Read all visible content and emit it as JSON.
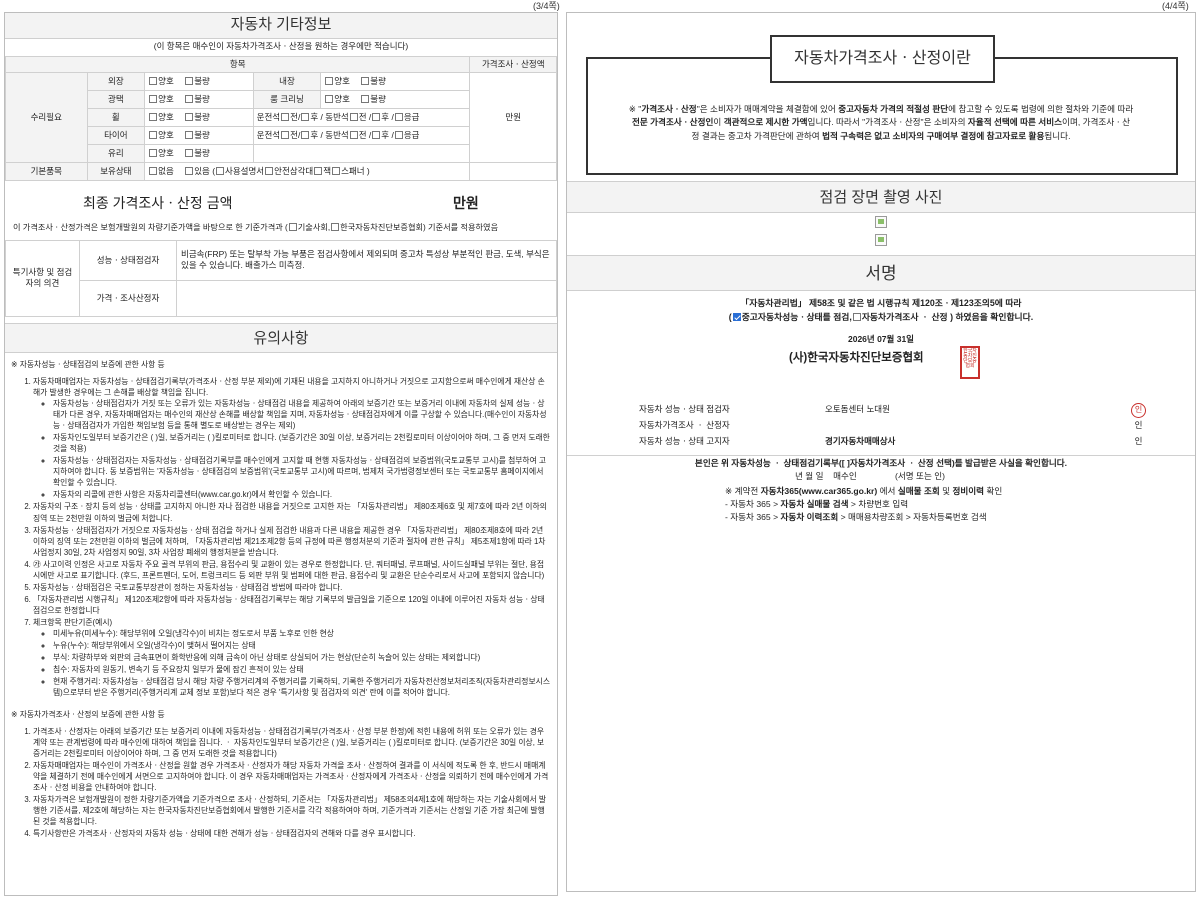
{
  "page_numbers": {
    "left": "(3/4쪽)",
    "right": "(4/4쪽)"
  },
  "other_info": {
    "title": "자동차 기타정보",
    "note": "(이 항목은 매수인이 자동차가격조사ㆍ산정을 원하는 경우에만 적습니다)",
    "col_item": "항목",
    "col_price": "가격조사ㆍ산정액",
    "repair_label": "수리필요",
    "basic_label": "기본품목",
    "unit_manwon": "만원",
    "opt_good": "양호",
    "opt_bad": "불량",
    "items": {
      "exterior": "외장",
      "interior": "내장",
      "gloss": "광택",
      "room_cleaning": "룸 크리닝",
      "wheel": "휠",
      "tire": "타이어",
      "glass": "유리",
      "possession": "보유상태"
    },
    "wheel_driver": "운전석",
    "passenger": "동반석",
    "front": "전",
    "rear": "후",
    "emergency": "응급",
    "possession_none": "없음",
    "possession_has": "있음 (",
    "manual": "사용설명서",
    "triangle": "안전삼각대",
    "jack": "잭",
    "spanner": "스패너 )"
  },
  "final_price": {
    "title": "최종 가격조사ㆍ산정 금액",
    "unit": "만원",
    "basis_pre": "이 가격조사ㆍ산정가격은 보험개발원의 차량기준가액을 바탕으로 한 기준가격과 (",
    "basis_opt1": "기술사회,",
    "basis_opt2": "한국자동차진단보증협회) 기준서를 적용하였음",
    "special_label": "특기사항 및 점검자의 의견",
    "perf_label": "성능ㆍ상태점검자",
    "perf_text": "비금속(FRP) 또는 탈부착 가능 부품은 점검사항에서 제외되며 중고차 특성상 부분적인 판금, 도색, 부식은 있을 수 있습니다. 배출가스 미측정.",
    "price_label": "가격ㆍ조사산정자"
  },
  "notice": {
    "title": "유의사항",
    "h1": "※ 자동차성능ㆍ상태점검의 보증에 관한 사항 등",
    "s1_1": "자동차매매업자는 자동차성능ㆍ상태점검기록부(가격조사ㆍ산정 부분 제외)에 기재된 내용을 고지하지 아니하거나 거짓으로 고지함으로써 매수인에게 재산상 손해가 발생한 경우에는 그 손해를 배상할 책임을 집니다.",
    "s1_sub1": "자동차성능ㆍ상태점검자가 거짓 또는 오류가 있는 자동차성능ㆍ상태점검 내용을 제공하여 아래의 보증기간 또는 보증거리 이내에 자동차의 실제 성능ㆍ상태가 다른 경우, 자동차매매업자는 매수인의 재산상 손해를 배상할 책임을 지며, 자동차성능ㆍ상태점검자에게 이를 구상할 수 있습니다.(매수인이 자동차성능ㆍ상태점검자가 가입한 책임보험 등을 통해 별도로 배상받는 경우는 제외)",
    "s1_sub2": "자동차인도일부터 보증기간은 (      )일, 보증거리는 (      )킬로미터로 합니다. (보증기간은 30일 이상, 보증거리는 2천킬로미터 이상이어야 하며, 그 중 먼저 도래한 것을 적용)",
    "s1_sub3": "자동차성능ㆍ상태점검자는 자동차성능ㆍ상태점검기록부를 매수인에게 고지할 때 현행 자동차성능ㆍ상태점검의 보증범위(국토교통부 고시)를 첨부하여 고지하여야 합니다. 동 보증범위는 '자동차성능ㆍ상태점검의 보증범위'(국토교통부 고시)에 따르며, 법제처 국가법령정보센터 또는 국토교통부 홈페이지에서 확인할 수 있습니다.",
    "s1_sub4": "자동차의 리콜에 관한 사항은 자동차리콜센터(www.car.go.kr)에서 확인할 수 있습니다.",
    "s2": "자동차의 구조ㆍ장치 등의 성능ㆍ상태를 고지하지 아니한 자나 점검한 내용을 거짓으로 고지한 자는 「자동차관리법」 제80조제6호 및 제7호에 따라 2년 이하의 징역 또는 2천만원 이하의 벌금에 처합니다.",
    "s3": "자동차성능ㆍ상태점검자가 거짓으로 자동차성능ㆍ상태 점검을 하거나 실제 점검한 내용과 다른 내용을 제공한 경우 「자동차관리법」 제80조제8호에 따라 2년 이하의 징역 또는 2천만원 이하의 벌금에 처하며, 「자동차관리법 제21조제2항 등의 규정에 따른 행정처분의 기준과 절차에 관한 규칙」 제5조제1항에 따라 1차 사업정지 30일, 2차 사업정지 90일, 3차 사업장 폐쇄의 행정처분을 받습니다.",
    "s4": "㉮ 사고이력 인정은 사고로 자동차 주요 골격 부위의 판금, 용접수리 및 교환이 있는 경우로 한정합니다. 단, 쿼터패널, 루프패널, 사이드실패널 부위는 절단, 용접 시에만 사고로 표기합니다. (후드, 프론트펜더, 도어, 트렁크리드 등 외판 부위 및 범퍼에 대한 판금, 용접수리 및 교환은 단순수리로서 사고에 포함되지 않습니다)",
    "s5": "자동차성능ㆍ상태점검은 국토교통부장관이 정하는 자동차성능ㆍ상태점검 방법에 따라야 합니다.",
    "s6": "「자동차관리법 시행규칙」 제120조제2항에 따라 자동차성능ㆍ상태점검기록부는 해당 기록부의 발급일을 기준으로 120일 이내에 이루어진 자동차 성능ㆍ상태점검으로 한정합니다",
    "s7": "체크항목 판단기준(예시)",
    "s7_sub1": "미세누유(미세누수): 해당부위에 오일(냉각수)이 비치는 정도로서 부품 노후로 인한 현상",
    "s7_sub2": "누유(누수): 해당부위에서 오일(냉각수)이 맺혀서 떨어지는 상태",
    "s7_sub3": "부식: 차량하부와 외판의 금속표면이 화학반응에 의해 금속이 아닌 상태로 상실되어 가는 현상(단순히 녹슬어 있는 상태는 제외합니다)",
    "s7_sub4": "침수: 자동차의 원동기, 변속기 등 주요장치 일부가 물에 잠긴 흔적이 있는 상태",
    "s7_sub5": "현재 주행거리: 자동차성능ㆍ상태점검 당시 해당 차량 주행거리계의 주행거리를 기록하되, 기록한 주행거리가 자동차전산정보처리조직(자동차관리정보시스템)으로부터 받은 주행거리(주행거리계 교체 정보 포함)보다 적은 경우 '특기사항 및 점검자의 의견' 란에 이를 적어야 합니다.",
    "h2": "※ 자동차가격조사ㆍ산정의 보증에 관한 사항 등",
    "p1": "가격조사ㆍ산정자는 아래의 보증기간 또는 보증거리 이내에 자동차성능ㆍ상태점검기록부(가격조사ㆍ산정 부분 한정)에 적힌 내용에 허위 또는 오류가 있는 경우 계약 또는 관계법령에 따라 매수인에 대하여 책임을 집니다. ㆍ 자동차인도일부터 보증기간은 (      )일, 보증거리는 (      )킬로미터로 합니다. (보증기간은 30일 이상, 보증거리는 2천킬로미터 이상이어야 하며, 그 중 먼저 도래한 것을 적용합니다)",
    "p2": "자동차매매업자는 매수인이 가격조사ㆍ산정을 원할 경우 가격조사ㆍ산정자가 해당 자동차 가격을 조사ㆍ산정하여 결과를 이 서식에 적도록 한 후, 반드시 매매계약을 체결하기 전에 매수인에게 서면으로 고지하여야 합니다. 이 경우 자동차매매업자는 가격조사ㆍ산정자에게 가격조사ㆍ산정을 의뢰하기 전에 매수인에게 가격조사ㆍ산정 비용을 안내하여야 합니다.",
    "p3": "자동차가격은 보험개발원이 정한 차량기준가액을 기준가격으로 조사ㆍ산정하되, 기준서는 「자동차관리법」 제58조의4제1호에 해당하는 자는 기술사회에서 발행한 기준서를, 제2호에 해당하는 자는 한국자동차진단보증협회에서 발행한 기준서를 각각 적용하여야 하며, 기준가격과 기준서는 산정일 기준 가장 최근에 발행된 것을 적용합니다.",
    "p4": "특기사항란은 가격조사ㆍ산정자의 자동차 성능ㆍ상태에 대한 견해가 성능ㆍ상태점검자의 견해와 다를 경우 표시합니다."
  },
  "about": {
    "title": "자동차가격조사ㆍ산정이란",
    "t1": "※ \"",
    "t2": "가격조사ㆍ산정",
    "t3": "\"은 소비자가 매매계약을 체결함에 있어 ",
    "t4": "중고자동차 가격의 적절성 판단",
    "t5": "에 참고할 수 있도록 법령에 의한 절차와 기준에 따라 ",
    "t6": "전문 가격조사ㆍ산정인",
    "t7": "이 ",
    "t8": "객관적으로 제시한 가액",
    "t9": "입니다. 따라서 \"가격조사ㆍ산정\"은 소비자의 ",
    "t10": "자율적 선택에 따른 서비스",
    "t11": "이며, 가격조사ㆍ산정 결과는 중고차 가격판단에 관하여 ",
    "t12": "법적 구속력은 없고 소비자의 구매여부 결정에 참고자료로 활용",
    "t13": "됩니다."
  },
  "photos": {
    "title": "점검 장면 촬영 사진"
  },
  "signature": {
    "title": "서명",
    "law_line": "「자동차관리법」 제58조 및 같은 법 시행규칙 제120조ㆍ제123조의5에 따라",
    "confirm_pre": "(",
    "confirm_opt1": "중고자동차성능ㆍ상태를 점검,",
    "confirm_opt2": "자동차가격조사 ㆍ 산정 ) 하였음을 확인합니다.",
    "date": "2026년 07월  31일",
    "org": "(사)한국자동차진단보증협회",
    "org_seal": "한국자동차진단보증협회",
    "rows": [
      {
        "role": "자동차 성능ㆍ상태 점검자",
        "name": "오토돔센터 노대원",
        "mark": "인"
      },
      {
        "role": "자동차가격조사 ㆍ 산정자",
        "name": "",
        "mark": "인"
      },
      {
        "role": "자동차 성능ㆍ상태 고지자",
        "name": "경기자동차매매상사",
        "mark": "인"
      }
    ],
    "buyer_line": "본인은 위 자동차성능 ㆍ 상태점검기록부([  ]자동차가격조사 ㆍ 산정 선택)를 발급받은 사실을 확인합니다.",
    "buyer_date": "년    월    일",
    "buyer_role": "매수인",
    "buyer_sign": "(서명 또는 인)",
    "info1_pre": "※ 계약전 ",
    "info1_site": "자동차365(www.car365.go.kr)",
    "info1_mid": " 에서 ",
    "info1_a": "실매물 조회",
    "info1_and": " 및 ",
    "info1_b": "정비이력",
    "info1_end": " 확인",
    "info2_pre": "- 자동차 365 > ",
    "info2_b": "자동차 실매물 검색",
    "info2_end": " > 차량번호 입력",
    "info3_pre": "- 자동차 365 > ",
    "info3_b": "자동차 이력조회",
    "info3_end": " > 매매용차량조회 > 자동차등록번호 검색"
  }
}
